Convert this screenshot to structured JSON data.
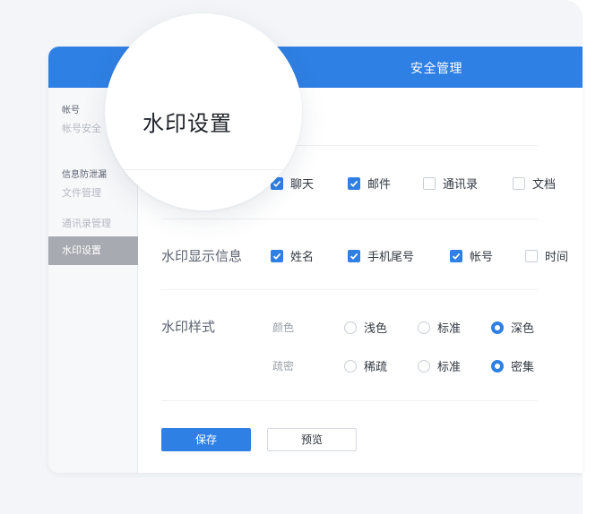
{
  "window": {
    "title": "安全管理"
  },
  "sidebar": {
    "groups": [
      {
        "label": "帐号",
        "items": [
          "帐号安全"
        ]
      },
      {
        "label": "信息防泄漏",
        "items": [
          "文件管理",
          "通讯录管理",
          "水印设置"
        ]
      }
    ],
    "active_item": "水印设置"
  },
  "page": {
    "title": "水印设置"
  },
  "sections": {
    "scope": {
      "options": [
        {
          "label": "聊天",
          "checked": true
        },
        {
          "label": "邮件",
          "checked": true
        },
        {
          "label": "通讯录",
          "checked": false
        },
        {
          "label": "文档",
          "checked": false
        }
      ]
    },
    "display_info": {
      "label": "水印显示信息",
      "options": [
        {
          "label": "姓名",
          "checked": true
        },
        {
          "label": "手机尾号",
          "checked": true
        },
        {
          "label": "帐号",
          "checked": true
        },
        {
          "label": "时间",
          "checked": false
        }
      ]
    },
    "style": {
      "label": "水印样式",
      "color": {
        "label": "颜色",
        "options": [
          "浅色",
          "标准",
          "深色"
        ],
        "selected": "深色"
      },
      "density": {
        "label": "疏密",
        "options": [
          "稀疏",
          "标准",
          "密集"
        ],
        "selected": "密集"
      }
    }
  },
  "actions": {
    "save_label": "保存",
    "preview_label": "预览"
  },
  "colors": {
    "accent": "#2f80e4",
    "sidebar_active": "#a7aab0"
  },
  "icons": [
    "checkmark-icon",
    "radio-dot-icon"
  ]
}
